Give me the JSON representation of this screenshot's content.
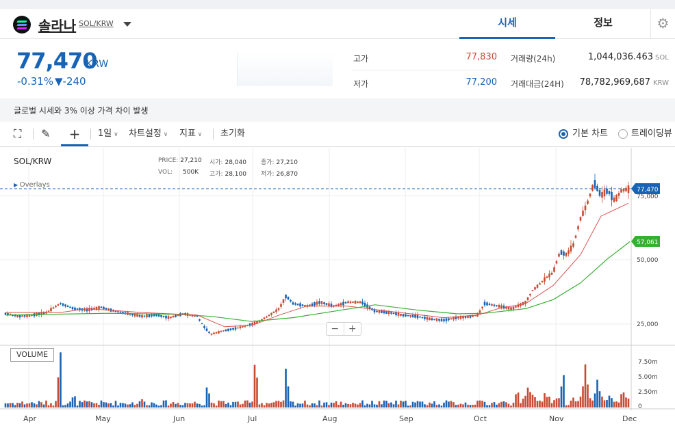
{
  "header": {
    "coin_name": "솔라나",
    "coin_pair": "SOL/KRW",
    "tabs": [
      "시세",
      "정보"
    ],
    "active_tab": "시세"
  },
  "price": {
    "current": "77,470",
    "unit": "KRW",
    "change_rate": "-0.31%",
    "change_amount": "▼-240"
  },
  "stats": {
    "high_label": "고가",
    "high_value": "77,830",
    "low_label": "저가",
    "low_value": "77,200",
    "volume_label": "거래량(24h)",
    "volume_value": "1,044,036.463",
    "volume_unit": "SOL",
    "amount_label": "거래대금(24H)",
    "amount_value": "78,782,969,687",
    "amount_unit": "KRW"
  },
  "notice": "글로벌 시세와 3% 이상 가격 차이 발생",
  "toolbar": {
    "interval": "1일",
    "chart_settings": "차트설정",
    "indicators": "지표",
    "reset": "초기화",
    "basic_chart": "기본 차트",
    "tradingview": "트레이딩뷰"
  },
  "ohlc": {
    "pair": "SOL/KRW",
    "price_label": "PRICE:",
    "price": "27,210",
    "open_label": "시가:",
    "open": "28,040",
    "close_label": "종가:",
    "close": "27,210",
    "vol_label": "VOL:",
    "vol": "500K",
    "high_label": "고가:",
    "high": "28,100",
    "low_label": "저가:",
    "low": "26,870",
    "overlays": "Overlays"
  },
  "colors": {
    "up": "#c84a31",
    "down": "#1763b6",
    "ma_short": "#d9534f",
    "ma_long": "#35b031",
    "accent": "#1763b6"
  },
  "chart_data": {
    "type": "candlestick",
    "price_axis": {
      "ticks": [
        25000,
        50000,
        75000
      ],
      "tick_labels": [
        "25,000",
        "50,000",
        "75,000"
      ]
    },
    "volume_axis": {
      "ticks": [
        0,
        2500000,
        5000000,
        7500000
      ],
      "tick_labels": [
        "0",
        "2.50m",
        "5.00m",
        "7.50m"
      ]
    },
    "x_ticks": [
      "Apr",
      "May",
      "Jun",
      "Jul",
      "Aug",
      "Sep",
      "Oct",
      "Nov",
      "Dec"
    ],
    "current_price_label": "77,470",
    "ma_long_label": "57,061",
    "volume_label": "VOLUME",
    "price_path": [
      [
        0,
        29000
      ],
      [
        20,
        28000
      ],
      [
        40,
        28500
      ],
      [
        60,
        29500
      ],
      [
        80,
        33000
      ],
      [
        100,
        31000
      ],
      [
        120,
        30500
      ],
      [
        140,
        31500
      ],
      [
        160,
        30000
      ],
      [
        180,
        29000
      ],
      [
        200,
        28000
      ],
      [
        220,
        28500
      ],
      [
        240,
        27500
      ],
      [
        260,
        29000
      ],
      [
        280,
        28000
      ],
      [
        290,
        24000
      ],
      [
        300,
        21000
      ],
      [
        320,
        22500
      ],
      [
        340,
        23500
      ],
      [
        360,
        25000
      ],
      [
        370,
        26000
      ],
      [
        380,
        27500
      ],
      [
        400,
        31000
      ],
      [
        410,
        36000
      ],
      [
        420,
        33000
      ],
      [
        440,
        32000
      ],
      [
        460,
        33500
      ],
      [
        480,
        32000
      ],
      [
        500,
        33500
      ],
      [
        520,
        33500
      ],
      [
        540,
        30000
      ],
      [
        560,
        29500
      ],
      [
        580,
        28500
      ],
      [
        600,
        28000
      ],
      [
        620,
        27000
      ],
      [
        640,
        26500
      ],
      [
        660,
        27500
      ],
      [
        680,
        28000
      ],
      [
        690,
        28500
      ],
      [
        700,
        33000
      ],
      [
        720,
        32000
      ],
      [
        740,
        31000
      ],
      [
        760,
        33500
      ],
      [
        770,
        38000
      ],
      [
        790,
        43000
      ],
      [
        800,
        45000
      ],
      [
        810,
        53000
      ],
      [
        820,
        52000
      ],
      [
        830,
        56000
      ],
      [
        840,
        66000
      ],
      [
        850,
        72000
      ],
      [
        860,
        80000
      ],
      [
        870,
        75000
      ],
      [
        880,
        77000
      ],
      [
        890,
        73000
      ],
      [
        900,
        77000
      ],
      [
        910,
        77470
      ]
    ],
    "ma_short": [
      [
        0,
        29500
      ],
      [
        80,
        29500
      ],
      [
        120,
        31000
      ],
      [
        200,
        29500
      ],
      [
        280,
        28500
      ],
      [
        320,
        24000
      ],
      [
        360,
        24500
      ],
      [
        400,
        28500
      ],
      [
        440,
        32000
      ],
      [
        500,
        32000
      ],
      [
        560,
        30000
      ],
      [
        640,
        27500
      ],
      [
        690,
        28500
      ],
      [
        720,
        31000
      ],
      [
        760,
        33000
      ],
      [
        800,
        40000
      ],
      [
        840,
        52000
      ],
      [
        870,
        67000
      ],
      [
        910,
        72000
      ]
    ],
    "ma_long": [
      [
        0,
        28500
      ],
      [
        150,
        29200
      ],
      [
        250,
        28800
      ],
      [
        300,
        28000
      ],
      [
        360,
        26000
      ],
      [
        420,
        27500
      ],
      [
        480,
        30000
      ],
      [
        540,
        32500
      ],
      [
        600,
        30500
      ],
      [
        660,
        29000
      ],
      [
        700,
        29200
      ],
      [
        760,
        31000
      ],
      [
        800,
        34500
      ],
      [
        840,
        41000
      ],
      [
        880,
        50500
      ],
      [
        912,
        57061
      ]
    ],
    "volume_peaks_m": [
      [
        80,
        10
      ],
      [
        100,
        2.5
      ],
      [
        200,
        1.5
      ],
      [
        295,
        4
      ],
      [
        365,
        8.5
      ],
      [
        410,
        7
      ],
      [
        695,
        1.5
      ],
      [
        765,
        2.5
      ],
      [
        815,
        4.5
      ],
      [
        847,
        6.5
      ],
      [
        865,
        4
      ]
    ]
  }
}
